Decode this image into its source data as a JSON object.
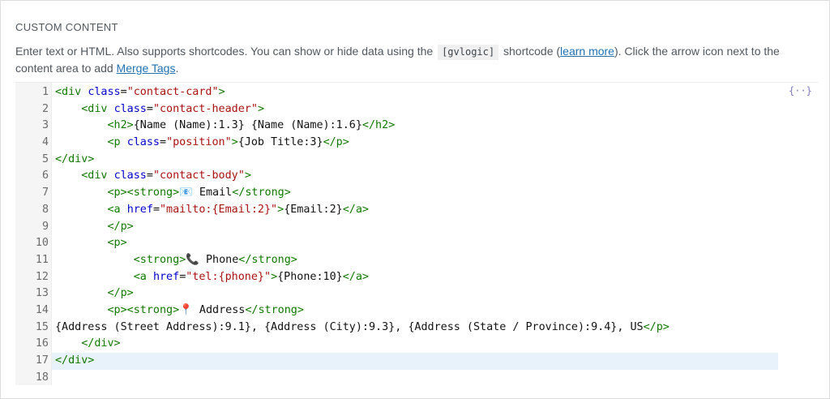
{
  "section": {
    "title": "CUSTOM CONTENT",
    "description_1": "Enter text or HTML. Also supports shortcodes. You can show or hide data using the",
    "gvlogic_chip": "[gvlogic]",
    "description_2": "shortcode (",
    "learn_more": "learn more",
    "description_3": "). Click the arrow icon next to the content area to add",
    "merge_tags_link": "Merge Tags",
    "description_4": "."
  },
  "merge_tags_button": {
    "label": "{··}",
    "icon": "merge-tags-icon"
  },
  "editor": {
    "active_line": 17,
    "colors": {
      "tag": "#117700",
      "attribute": "#0000cc",
      "string": "#aa1111",
      "highlight": "#e8f2fb"
    },
    "lines": [
      {
        "n": "1",
        "indent": "",
        "tokens": [
          [
            "tag",
            "<div "
          ],
          [
            "attr",
            "class"
          ],
          [
            "txt",
            "="
          ],
          [
            "str",
            "\"contact-card\""
          ],
          [
            "tag",
            ">"
          ]
        ]
      },
      {
        "n": "2",
        "indent": "    ",
        "tokens": [
          [
            "tag",
            "<div "
          ],
          [
            "attr",
            "class"
          ],
          [
            "txt",
            "="
          ],
          [
            "str",
            "\"contact-header\""
          ],
          [
            "tag",
            ">"
          ]
        ]
      },
      {
        "n": "3",
        "indent": "        ",
        "tokens": [
          [
            "tag",
            "<h2>"
          ],
          [
            "txt",
            "{Name (Name):1.3} {Name (Name):1.6}"
          ],
          [
            "tag",
            "</h2>"
          ]
        ]
      },
      {
        "n": "4",
        "indent": "        ",
        "tokens": [
          [
            "tag",
            "<p "
          ],
          [
            "attr",
            "class"
          ],
          [
            "txt",
            "="
          ],
          [
            "str",
            "\"position\""
          ],
          [
            "tag",
            ">"
          ],
          [
            "txt",
            "{Job Title:3}"
          ],
          [
            "tag",
            "</p>"
          ]
        ]
      },
      {
        "n": "5",
        "indent": "",
        "tokens": [
          [
            "tag",
            "</div>"
          ]
        ]
      },
      {
        "n": "6",
        "indent": "    ",
        "tokens": [
          [
            "tag",
            "<div "
          ],
          [
            "attr",
            "class"
          ],
          [
            "txt",
            "="
          ],
          [
            "str",
            "\"contact-body\""
          ],
          [
            "tag",
            ">"
          ]
        ]
      },
      {
        "n": "7",
        "indent": "        ",
        "tokens": [
          [
            "tag",
            "<p><strong>"
          ],
          [
            "txt",
            "📧 Email"
          ],
          [
            "tag",
            "</strong>"
          ]
        ]
      },
      {
        "n": "8",
        "indent": "        ",
        "tokens": [
          [
            "tag",
            "<a "
          ],
          [
            "attr",
            "href"
          ],
          [
            "txt",
            "="
          ],
          [
            "str",
            "\"mailto:{Email:2}\""
          ],
          [
            "tag",
            ">"
          ],
          [
            "txt",
            "{Email:2}"
          ],
          [
            "tag",
            "</a>"
          ]
        ]
      },
      {
        "n": "9",
        "indent": "        ",
        "tokens": [
          [
            "tag",
            "</p>"
          ]
        ]
      },
      {
        "n": "10",
        "indent": "        ",
        "tokens": [
          [
            "tag",
            "<p>"
          ]
        ]
      },
      {
        "n": "11",
        "indent": "            ",
        "tokens": [
          [
            "tag",
            "<strong>"
          ],
          [
            "txt",
            "📞 Phone"
          ],
          [
            "tag",
            "</strong>"
          ]
        ]
      },
      {
        "n": "12",
        "indent": "            ",
        "tokens": [
          [
            "tag",
            "<a "
          ],
          [
            "attr",
            "href"
          ],
          [
            "txt",
            "="
          ],
          [
            "str",
            "\"tel:{phone}\""
          ],
          [
            "tag",
            ">"
          ],
          [
            "txt",
            "{Phone:10}"
          ],
          [
            "tag",
            "</a>"
          ]
        ]
      },
      {
        "n": "13",
        "indent": "        ",
        "tokens": [
          [
            "tag",
            "</p>"
          ]
        ]
      },
      {
        "n": "14",
        "indent": "        ",
        "tokens": [
          [
            "tag",
            "<p><strong>"
          ],
          [
            "txt",
            "📍 Address"
          ],
          [
            "tag",
            "</strong>"
          ]
        ]
      },
      {
        "n": "15",
        "indent": "",
        "tokens": [
          [
            "txt",
            "{Address (Street Address):9.1}, {Address (City):9.3}, {Address (State / Province):9.4}, US"
          ],
          [
            "tag",
            "</p>"
          ]
        ]
      },
      {
        "n": "16",
        "indent": "    ",
        "tokens": [
          [
            "tag",
            "</div>"
          ]
        ]
      },
      {
        "n": "17",
        "indent": "",
        "tokens": [
          [
            "tag",
            "</div>"
          ]
        ]
      },
      {
        "n": "18",
        "indent": "",
        "tokens": []
      }
    ]
  }
}
